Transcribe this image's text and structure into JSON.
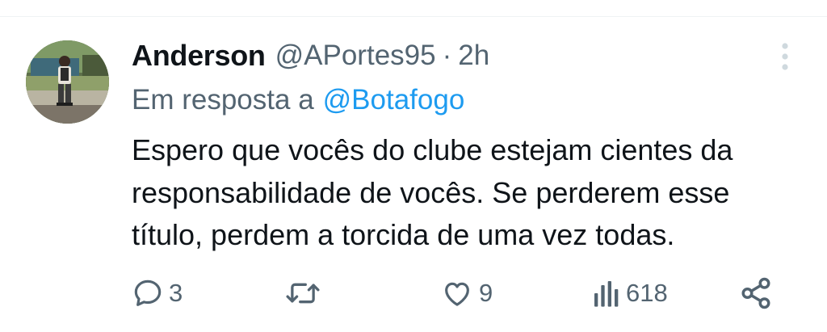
{
  "tweet": {
    "author_name": "Anderson",
    "author_handle": "@APortes95",
    "separator": "·",
    "time_ago": "2h",
    "reply_prefix": "Em resposta a",
    "reply_to": "@Botafogo",
    "text": "Espero que vocês do clube estejam cientes da\nresponsabilidade de vocês. Se perderem esse\ntítulo, perdem a torcida de uma vez todas."
  },
  "actions": {
    "replies": "3",
    "reposts": "",
    "likes": "9",
    "views": "618"
  },
  "icons": {
    "reply": "speech-bubble-icon",
    "repost": "repost-arrows-icon",
    "like": "heart-icon",
    "views": "bar-chart-icon",
    "share": "share-icon",
    "more": "vertical-dots-icon"
  },
  "colors": {
    "text": "#0f1419",
    "secondary": "#536471",
    "link": "#1d9bf0",
    "more_dots": "#cfd9de",
    "divider": "#eff3f4"
  }
}
